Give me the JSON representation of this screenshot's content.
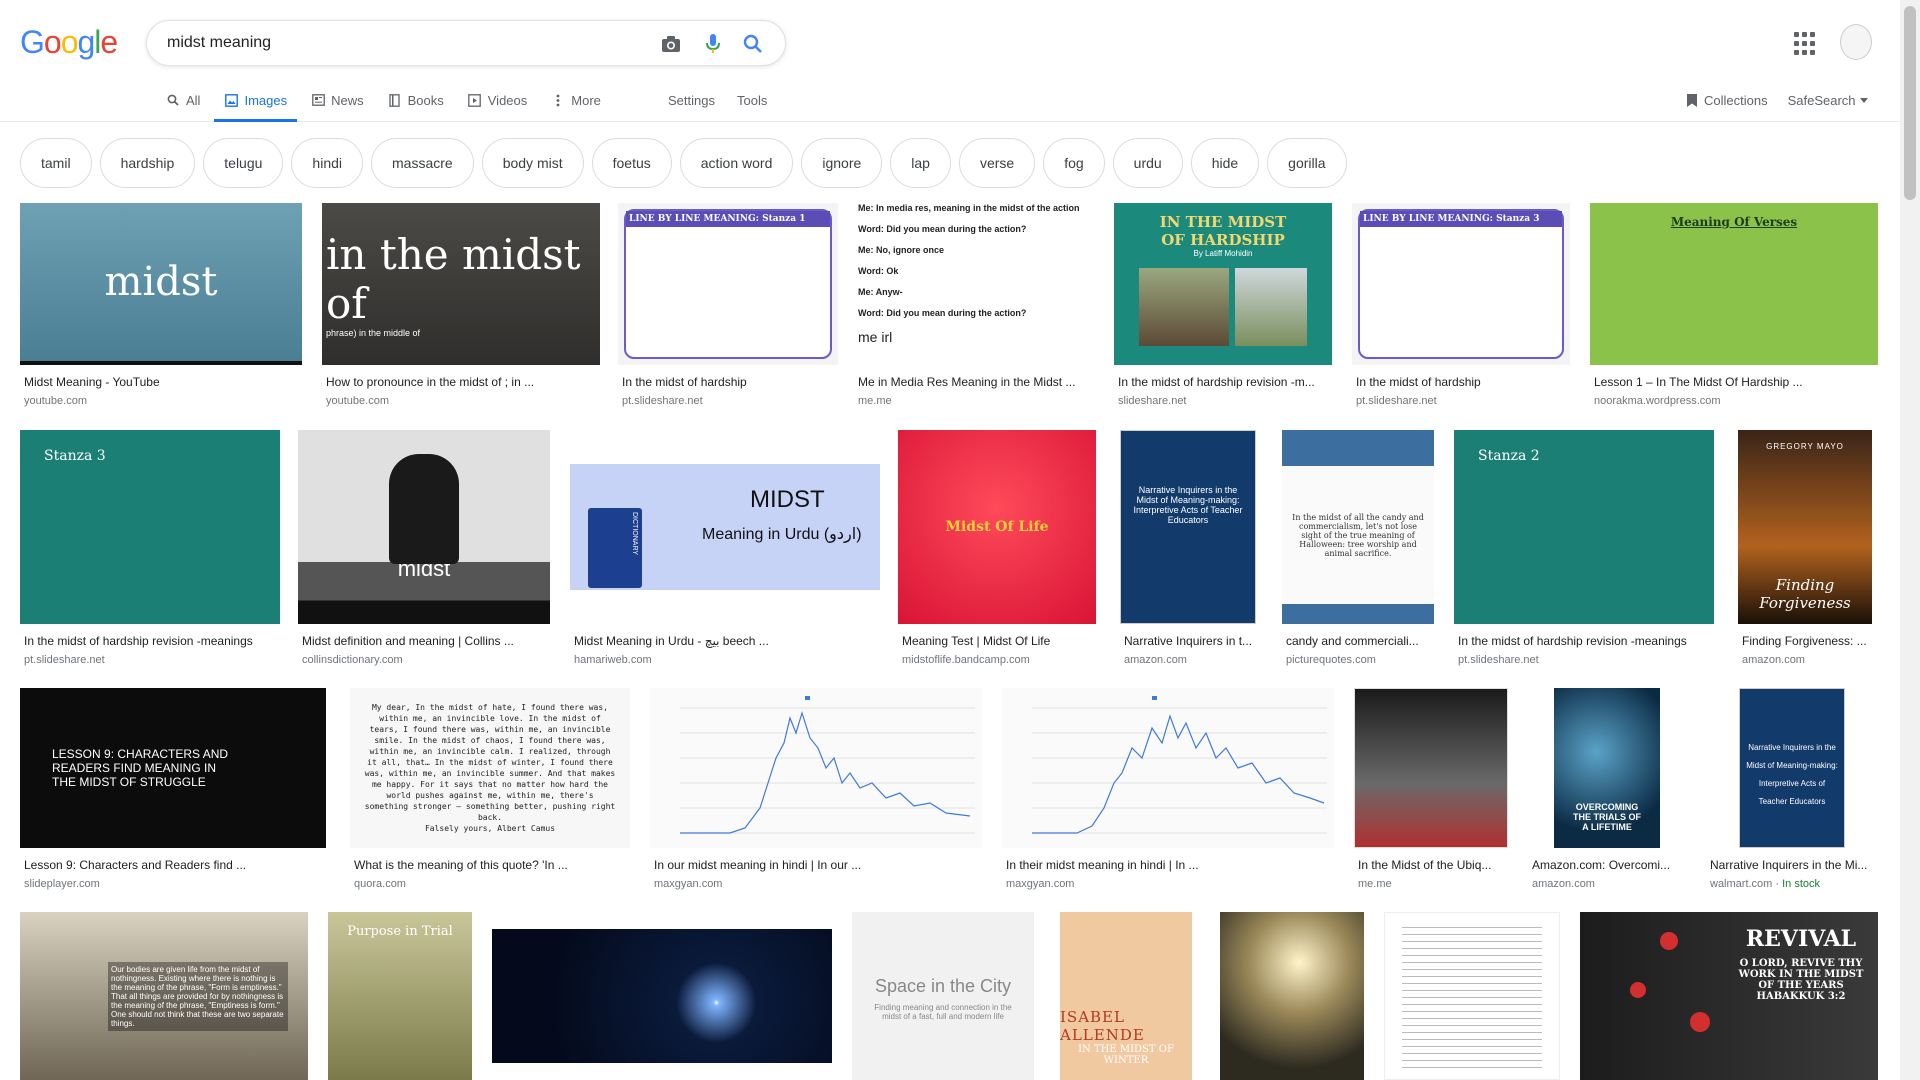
{
  "search": {
    "query": "midst meaning"
  },
  "logo": {
    "letters": [
      "G",
      "o",
      "o",
      "g",
      "l",
      "e"
    ]
  },
  "tabs": [
    {
      "label": "All",
      "icon": "search-icon"
    },
    {
      "label": "Images",
      "icon": "image-icon"
    },
    {
      "label": "News",
      "icon": "newspaper-icon"
    },
    {
      "label": "Books",
      "icon": "book-icon"
    },
    {
      "label": "Videos",
      "icon": "video-icon"
    },
    {
      "label": "More",
      "icon": "more-dots-icon"
    }
  ],
  "tools": {
    "settings": "Settings",
    "tools": "Tools"
  },
  "right": {
    "collections": "Collections",
    "safesearch": "SafeSearch"
  },
  "chips": [
    "tamil",
    "hardship",
    "telugu",
    "hindi",
    "massacre",
    "body mist",
    "foetus",
    "action word",
    "ignore",
    "lap",
    "verse",
    "fog",
    "urdu",
    "hide",
    "gorilla"
  ],
  "row1": [
    {
      "caption": "Midst Meaning - YouTube",
      "source": "youtube.com",
      "thumb_text": "midst"
    },
    {
      "caption": "How to pronounce in the midst of ; in ...",
      "source": "youtube.com",
      "thumb_text": "in the midst of",
      "thumb_sub": "phrase) in the middle of"
    },
    {
      "caption": "In the midst of hardship",
      "source": "pt.slideshare.net",
      "thumb_text": "LINE BY LINE MEANING: Stanza 1"
    },
    {
      "caption": "Me in Media Res Meaning in the Midst ...",
      "source": "me.me",
      "thumb_lines": [
        "Me: In media res, meaning in the midst of the action",
        "Word: Did you mean during the action?",
        "Me: No, ignore once",
        "Word: Ok",
        "Me: Anyw-",
        "Word: Did you mean during the action?",
        "me irl"
      ]
    },
    {
      "caption": "In the midst of hardship revision -m...",
      "source": "slideshare.net",
      "thumb_text": "IN THE MIDST OF HARDSHIP",
      "thumb_sub": "By Latiff Mohidin"
    },
    {
      "caption": "In the midst of hardship",
      "source": "pt.slideshare.net",
      "thumb_text": "LINE BY LINE MEANING: Stanza 3"
    },
    {
      "caption": "Lesson 1 – In The Midst Of Hardship ...",
      "source": "noorakma.wordpress.com",
      "thumb_text": "Meaning Of Verses"
    }
  ],
  "row2": [
    {
      "caption": "In the midst of hardship revision -meanings",
      "source": "pt.slideshare.net",
      "thumb_text": "Stanza 3"
    },
    {
      "caption": "Midst definition and meaning | Collins ...",
      "source": "collinsdictionary.com",
      "thumb_text": "midst"
    },
    {
      "caption": "Midst Meaning in Urdu - بیچ beech ...",
      "source": "hamariweb.com",
      "thumb_text": "MIDST",
      "thumb_sub": "Meaning in Urdu (اردو)"
    },
    {
      "caption": "Meaning Test | Midst Of Life",
      "source": "midstoflife.bandcamp.com",
      "thumb_text": "Midst Of Life"
    },
    {
      "caption": "Narrative Inquirers in t...",
      "source": "amazon.com",
      "thumb_text": "Narrative Inquirers in the Midst of Meaning-making: Interpretive Acts of Teacher Educators"
    },
    {
      "caption": "candy and commerciali...",
      "source": "picturequotes.com",
      "thumb_text": "In the midst of all the candy and commercialism, let's not lose sight of the true meaning of Halloween: tree worship and animal sacrifice."
    },
    {
      "caption": "In the midst of hardship revision -meanings",
      "source": "pt.slideshare.net",
      "thumb_text": "Stanza 2"
    },
    {
      "caption": "Finding Forgiveness: ...",
      "source": "amazon.com",
      "thumb_text": "Finding Forgiveness",
      "thumb_sub": "GREGORY MAYO"
    }
  ],
  "row3": [
    {
      "caption": "Lesson 9: Characters and Readers find ...",
      "source": "slideplayer.com",
      "thumb_text": "LESSON 9: CHARACTERS AND READERS FIND MEANING IN THE MIDST OF STRUGGLE"
    },
    {
      "caption": "What is the meaning of this quote? 'In ...",
      "source": "quora.com",
      "thumb_text": "My dear, In the midst of hate, I found there was, within me, an invincible love. In the midst of tears, I found there was, within me, an invincible smile. In the midst of chaos, I found there was, within me, an invincible calm. I realized, through it all, that… In the midst of winter, I found there was, within me, an invincible summer. And that makes me happy. For it says that no matter how hard the world pushes against me, within me, there's something stronger – something better, pushing right back.",
      "thumb_sub": "Falsely yours, Albert Camus"
    },
    {
      "caption": "In our midst meaning in hindi | In our ...",
      "source": "maxgyan.com"
    },
    {
      "caption": "In their midst meaning in hindi | In ...",
      "source": "maxgyan.com"
    },
    {
      "caption": "In the Midst of the Ubiq...",
      "source": "me.me"
    },
    {
      "caption": "Amazon.com: Overcomi...",
      "source": "amazon.com",
      "thumb_text": "OVERCOMING THE TRIALS OF A LIFETIME"
    },
    {
      "caption": "Narrative Inquirers in the Mi...",
      "source": "walmart.com",
      "source_extra": "In stock",
      "thumb_text": "Narrative Inquirers in the Midst of Meaning-making: Interpretive Acts of Teacher Educators"
    }
  ],
  "row4": [
    {
      "thumb_text": "Our bodies are given life from the midst of nothingness. Existing where there is nothing is the meaning of the phrase, \"Form is emptiness.\" That all things are provided for by nothingness is the meaning of the phrase, \"Emptiness is form.\" One should not think that these are two separate things."
    },
    {
      "thumb_text": "Purpose in Trial"
    },
    {
      "thumb_text": ""
    },
    {
      "thumb_text": "Space in the City",
      "thumb_sub": "Finding meaning and connection in the midst of a fast, full and modern life"
    },
    {
      "thumb_text": "ISABEL ALLENDE",
      "thumb_sub": "IN THE MIDST OF WINTER"
    },
    {
      "thumb_text": ""
    },
    {
      "thumb_text": ""
    },
    {
      "thumb_text": "REVIVAL",
      "thumb_sub": "O LORD, REVIVE THY WORK IN THE MIDST OF THE YEARS HABAKKUK 3:2"
    }
  ],
  "colors": {
    "accent": "#1a73e8",
    "g_blue": "#4285f4",
    "g_red": "#ea4335",
    "g_yellow": "#fbbc05",
    "g_green": "#34a853"
  }
}
